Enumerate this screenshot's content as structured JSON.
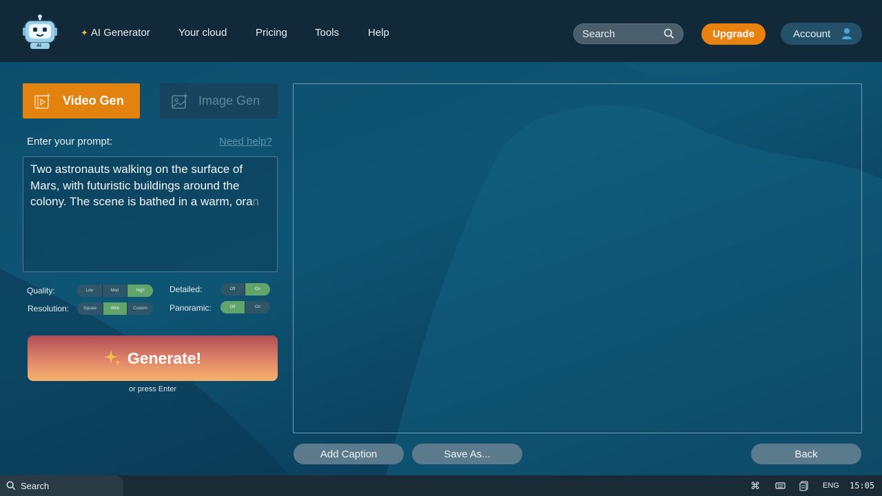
{
  "nav": {
    "ai_generator": "AI Generator",
    "your_cloud": "Your cloud",
    "pricing": "Pricing",
    "tools": "Tools",
    "help": "Help",
    "search_label": "Search",
    "upgrade": "Upgrade",
    "account": "Account"
  },
  "logo": {
    "text": "AI"
  },
  "tabs": {
    "video": "Video Gen",
    "image": "Image Gen",
    "active": "video"
  },
  "prompt": {
    "label": "Enter your prompt:",
    "help_link": "Need help?",
    "text": "Two astronauts walking on the surface of Mars, with futuristic buildings around the colony. The scene is bathed in a warm, ora",
    "text_fade": "n"
  },
  "options": {
    "quality": {
      "label": "Quality:",
      "choices": [
        "Low",
        "Med",
        "High"
      ],
      "selected": "High"
    },
    "resolution": {
      "label": "Resolution:",
      "choices": [
        "Square",
        "Web",
        "Custom"
      ],
      "selected": "Web"
    },
    "detailed": {
      "label": "Detailed:",
      "choices": [
        "Off",
        "On"
      ],
      "selected": "On"
    },
    "panoramic": {
      "label": "Panoramic:",
      "choices": [
        "Off",
        "On"
      ],
      "selected": "Off"
    }
  },
  "generate": {
    "label": "Generate!",
    "hint": "or press Enter"
  },
  "actions": {
    "add_caption": "Add Caption",
    "save_as": "Save As...",
    "back": "Back"
  },
  "taskbar": {
    "search": "Search",
    "language": "ENG",
    "time": "15:05"
  },
  "colors": {
    "accent": "#e8820e",
    "active_toggle": "#62a56c",
    "nav_bg": "#12293a"
  }
}
